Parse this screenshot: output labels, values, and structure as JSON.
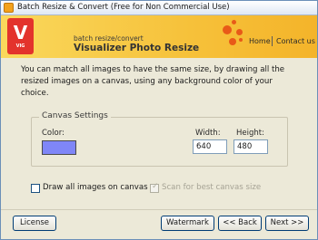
{
  "window": {
    "title": "Batch Resize & Convert (Free for Non Commercial Use)"
  },
  "header": {
    "logo_letter": "V",
    "logo_subtext": "VIG",
    "small_title": "batch resize/convert",
    "big_title": "Visualizer Photo Resize",
    "links": {
      "home": "Home",
      "separator": "|",
      "contact": "Contact us"
    }
  },
  "main": {
    "description": "You can match all images to have the same size, by drawing all the resized images on a canvas, using any background color of your choice.",
    "canvas_settings": {
      "title": "Canvas Settings",
      "color_label": "Color:",
      "color_value": "#7f86f7",
      "width_label": "Width:",
      "width_value": "640",
      "height_label": "Height:",
      "height_value": "480"
    },
    "options": {
      "draw_all_label": "Draw all images on canvas",
      "draw_all_checked": false,
      "scan_best_label": "Scan for best canvas size",
      "scan_best_checked": true,
      "scan_best_enabled": false
    }
  },
  "footer": {
    "license_label": "License",
    "watermark_label": "Watermark",
    "back_label": "<< Back",
    "next_label": "Next >>"
  },
  "colors": {
    "header_gradient_start": "#fad85c",
    "header_gradient_end": "#f4b42a",
    "logo_red": "#e3332c",
    "accent_orange": "#e85a18",
    "dialog_bg": "#ece9d8"
  }
}
